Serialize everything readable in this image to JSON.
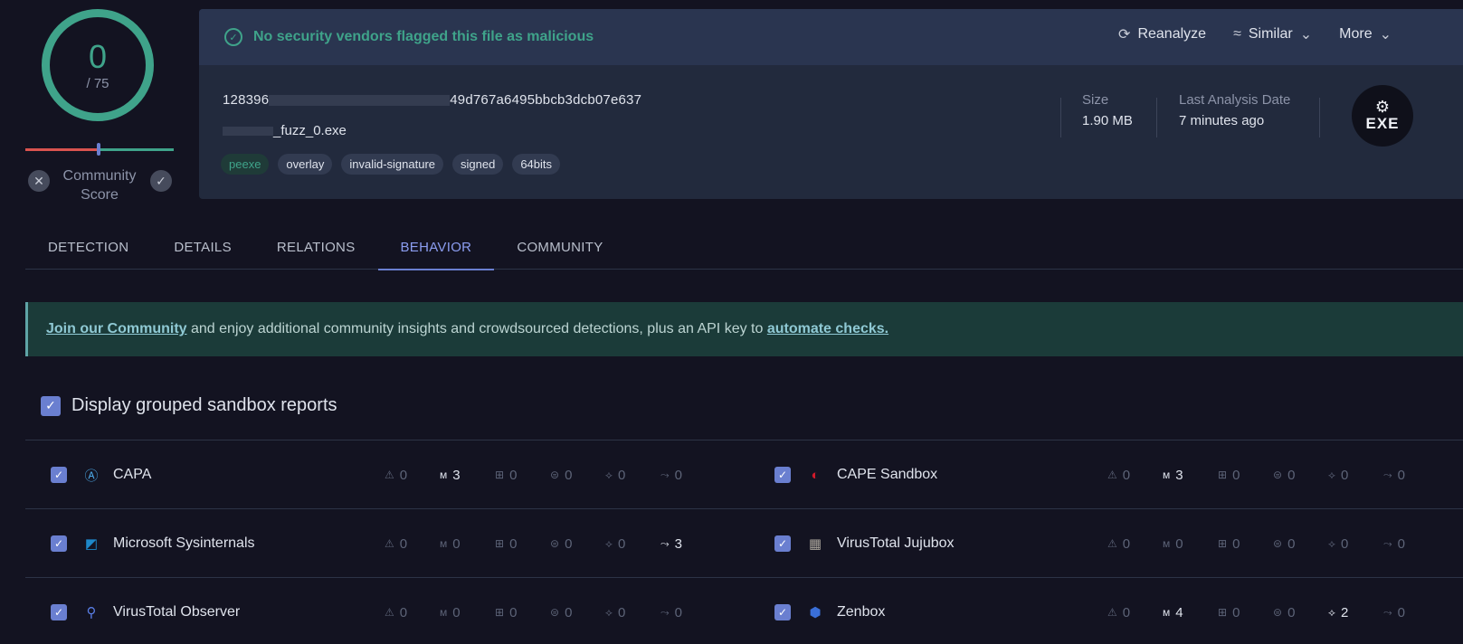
{
  "score": {
    "detections": "0",
    "total": "/ 75",
    "label": "Community Score"
  },
  "banner": {
    "message": "No security vendors flagged this file as malicious",
    "actions": [
      {
        "label": "Reanalyze",
        "icon": "refresh-icon"
      },
      {
        "label": "Similar",
        "icon": "similar-icon"
      },
      {
        "label": "More",
        "icon": "chevron-down-icon"
      }
    ]
  },
  "file": {
    "hash_start": "128396",
    "hash_end": "49d767a6495bbcb3dcb07e637",
    "name_suffix": "_fuzz_0.exe",
    "tags": [
      "peexe",
      "overlay",
      "invalid-signature",
      "signed",
      "64bits"
    ],
    "size_label": "Size",
    "size_value": "1.90 MB",
    "date_label": "Last Analysis Date",
    "date_value": "7 minutes ago",
    "type_badge": "EXE"
  },
  "tabs": [
    "DETECTION",
    "DETAILS",
    "RELATIONS",
    "BEHAVIOR",
    "COMMUNITY"
  ],
  "active_tab": "BEHAVIOR",
  "join": {
    "link1": "Join our Community",
    "middle": " and enjoy additional community insights and crowdsourced detections, plus an API key to ",
    "link2": "automate checks."
  },
  "group_toggle": "Display grouped sandbox reports",
  "sandboxes": [
    {
      "name": "CAPA",
      "stats": [
        "0",
        "3",
        "0",
        "0",
        "0",
        "0"
      ]
    },
    {
      "name": "CAPE Sandbox",
      "stats": [
        "0",
        "3",
        "0",
        "0",
        "0",
        "0"
      ]
    },
    {
      "name": "Microsoft Sysinternals",
      "stats": [
        "0",
        "0",
        "0",
        "0",
        "0",
        "3"
      ]
    },
    {
      "name": "VirusTotal Jujubox",
      "stats": [
        "0",
        "0",
        "0",
        "0",
        "0",
        "0"
      ]
    },
    {
      "name": "VirusTotal Observer",
      "stats": [
        "0",
        "0",
        "0",
        "0",
        "0",
        "0"
      ]
    },
    {
      "name": "Zenbox",
      "stats": [
        "0",
        "4",
        "0",
        "0",
        "2",
        "0"
      ]
    }
  ],
  "colors": {
    "accent": "#6a7fd0",
    "clean": "#3fa38a",
    "malicious": "#d9534f"
  }
}
